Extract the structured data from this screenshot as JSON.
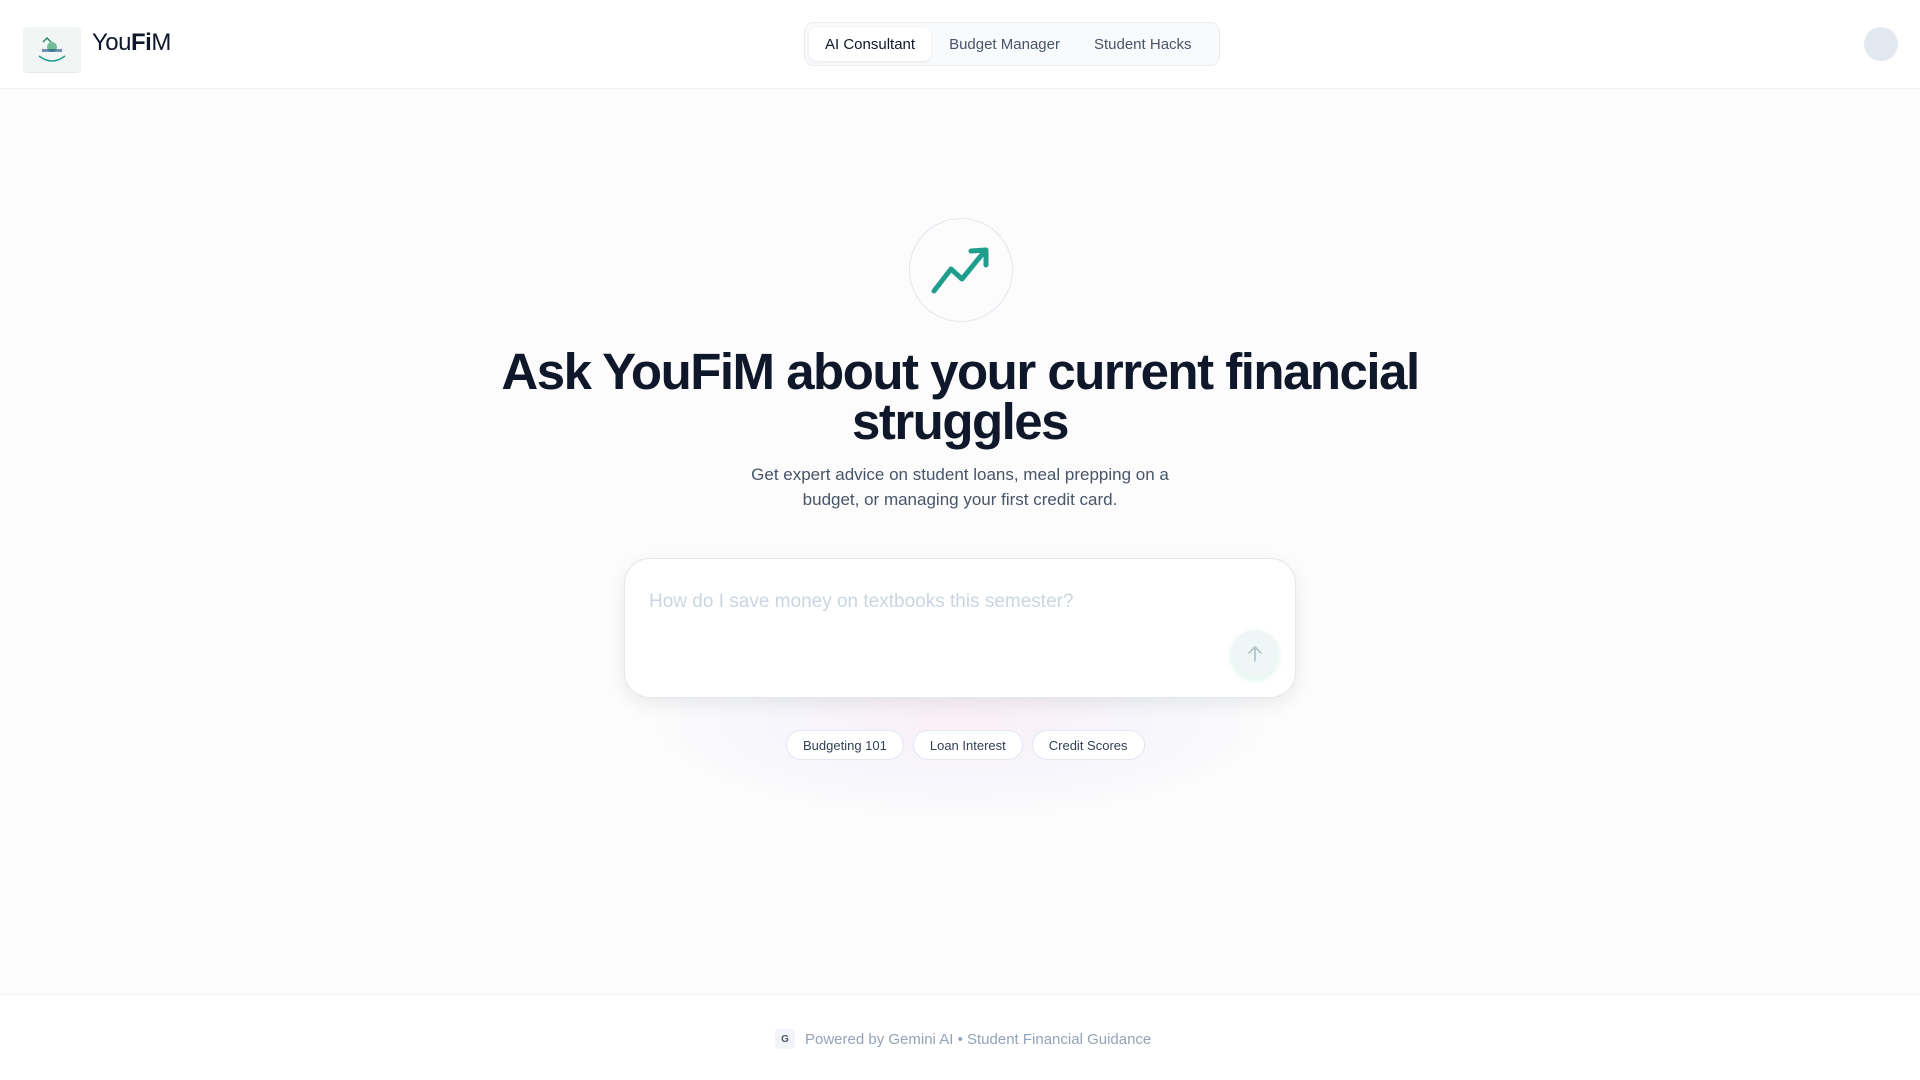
{
  "header": {
    "brand_prefix": "You",
    "brand_bold": "Fi",
    "brand_suffix": "M",
    "tabs": [
      {
        "label": "AI Consultant",
        "active": true
      },
      {
        "label": "Budget Manager",
        "active": false
      },
      {
        "label": "Student Hacks",
        "active": false
      }
    ]
  },
  "hero": {
    "icon": "trending-up-icon",
    "headline": "Ask YouFiM about your current financial struggles",
    "subtitle": "Get expert advice on student loans, meal prepping on a budget, or managing your first credit card."
  },
  "ask": {
    "placeholder": "How do I save money on textbooks this semester?",
    "value": "",
    "send_icon": "arrow-up-icon"
  },
  "suggestions": [
    "Budgeting 101",
    "Loan Interest",
    "Credit Scores"
  ],
  "footer": {
    "badge": "G",
    "text": "Powered by Gemini AI • Student Financial Guidance"
  },
  "colors": {
    "accent": "#1f9e8e",
    "text_primary": "#0f172a",
    "text_secondary": "#475569",
    "muted": "#94a3b8"
  }
}
